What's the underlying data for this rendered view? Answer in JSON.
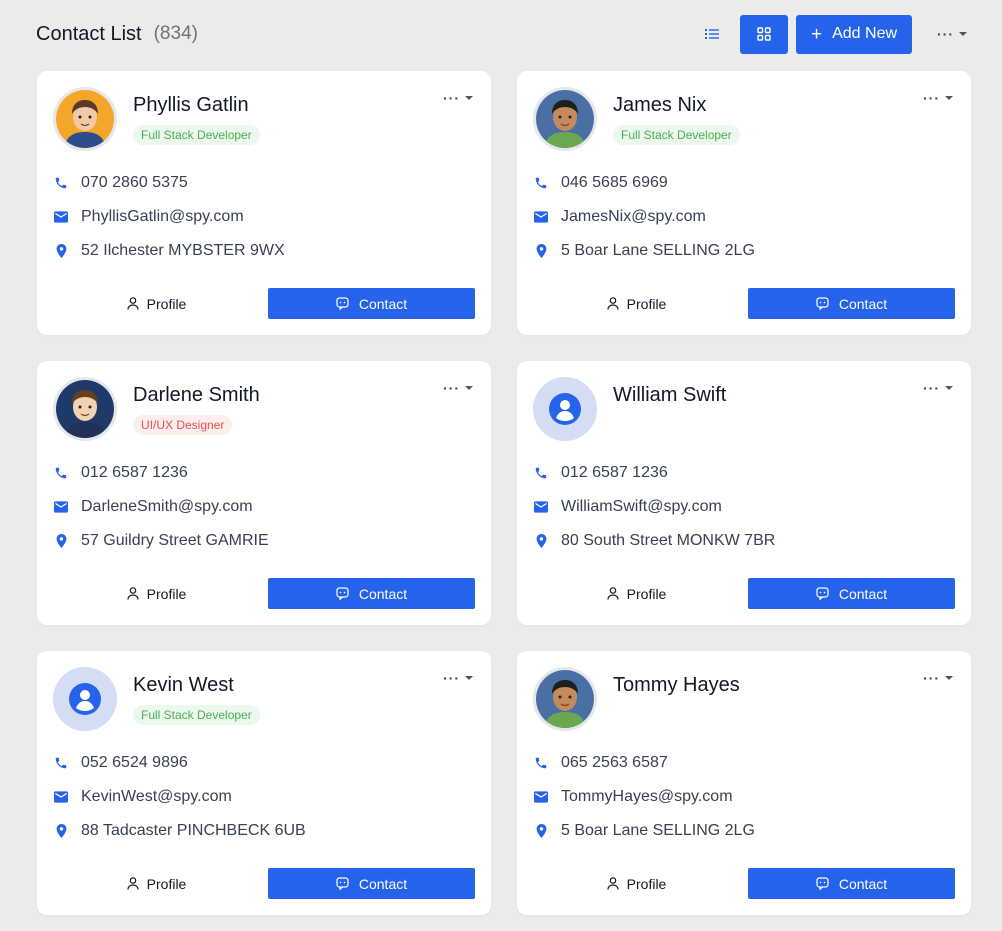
{
  "header": {
    "title": "Contact List",
    "count": "(834)",
    "add_label": "Add New",
    "list_icon": "list-view-icon",
    "grid_icon": "grid-view-icon",
    "more_icon": "more-dots-icon"
  },
  "colors": {
    "accent": "#2563eb",
    "background": "#ebebeb",
    "dev_badge_text": "#4caf50",
    "design_badge_text": "#e05252"
  },
  "contacts": [
    {
      "name": "Phyllis Gatlin",
      "role": "Full Stack Developer",
      "role_type": "dev",
      "phone": "070 2860 5375",
      "email": "PhyllisGatlin@spy.com",
      "address": "52 Ilchester MYBSTER 9WX",
      "avatar": "avatar-illustration"
    },
    {
      "name": "James Nix",
      "role": "Full Stack Developer",
      "role_type": "dev",
      "phone": "046 5685 6969",
      "email": "JamesNix@spy.com",
      "address": "5 Boar Lane SELLING 2LG",
      "avatar": "avatar-illustration"
    },
    {
      "name": "Darlene Smith",
      "role": "UI/UX Designer",
      "role_type": "design",
      "phone": "012 6587 1236",
      "email": "DarleneSmith@spy.com",
      "address": "57 Guildry Street GAMRIE",
      "avatar": "avatar-illustration"
    },
    {
      "name": "William Swift",
      "role": "",
      "role_type": "",
      "phone": "012 6587 1236",
      "email": "WilliamSwift@spy.com",
      "address": "80 South Street MONKW 7BR",
      "avatar": "user-placeholder-icon"
    },
    {
      "name": "Kevin West",
      "role": "Full Stack Developer",
      "role_type": "dev",
      "phone": "052 6524 9896",
      "email": "KevinWest@spy.com",
      "address": "88 Tadcaster PINCHBECK 6UB",
      "avatar": "user-placeholder-icon"
    },
    {
      "name": "Tommy Hayes",
      "role": "",
      "role_type": "",
      "phone": "065 2563 6587",
      "email": "TommyHayes@spy.com",
      "address": "5 Boar Lane SELLING 2LG",
      "avatar": "avatar-illustration"
    }
  ],
  "card_actions": {
    "profile_label": "Profile",
    "contact_label": "Contact"
  }
}
